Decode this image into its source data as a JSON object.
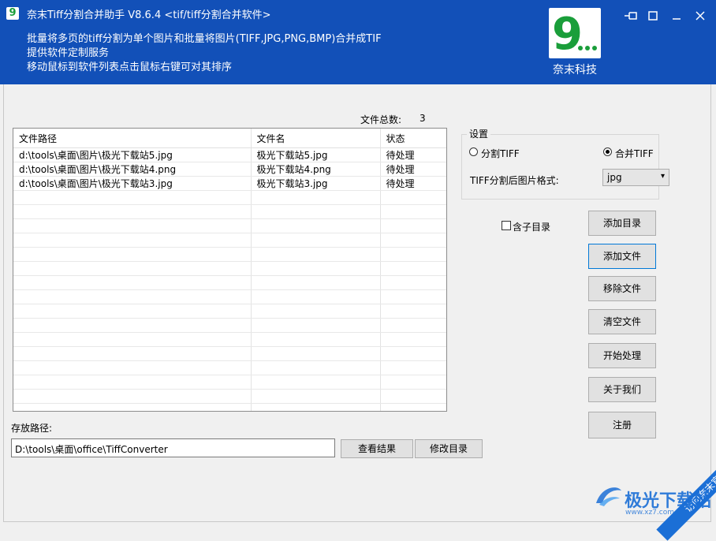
{
  "window": {
    "title": "奈末Tiff分割合并助手 V8.6.4   <tif/tiff分割合并软件>",
    "lines": [
      "批量将多页的tiff分割为单个图片和批量将图片(TIFF,JPG,PNG,BMP)合并成TIF",
      "提供软件定制服务",
      "移动鼠标到软件列表点击鼠标右键可对其排序"
    ],
    "logo_label": "奈末科技",
    "logo_glyph": "9",
    "app_icon_glyph": "9"
  },
  "file_count": {
    "label": "文件总数:",
    "value": "3"
  },
  "table": {
    "columns": [
      "文件路径",
      "文件名",
      "状态"
    ],
    "rows": [
      [
        "d:\\tools\\桌面\\图片\\极光下载站5.jpg",
        "极光下载站5.jpg",
        "待处理"
      ],
      [
        "d:\\tools\\桌面\\图片\\极光下载站4.png",
        "极光下载站4.png",
        "待处理"
      ],
      [
        "d:\\tools\\桌面\\图片\\极光下载站3.jpg",
        "极光下载站3.jpg",
        "待处理"
      ]
    ]
  },
  "settings": {
    "title": "设置",
    "split_label": "分割TIFF",
    "merge_label": "合并TIFF",
    "selected_mode": "merge",
    "format_label": "TIFF分割后图片格式:",
    "format_value": "jpg"
  },
  "subdir_label": "含子目录",
  "buttons": {
    "add_dir": "添加目录",
    "add_file": "添加文件",
    "remove_file": "移除文件",
    "clear_files": "清空文件",
    "start": "开始处理",
    "about": "关于我们",
    "register": "注册",
    "view_result": "查看结果",
    "change_dir": "修改目录"
  },
  "output": {
    "label": "存放路径:",
    "path": "D:\\tools\\桌面\\office\\TiffConverter"
  },
  "watermark": {
    "ribbon": "访问奈末官网",
    "site_name": "极光下载站",
    "site_url": "www.xz7.com"
  }
}
